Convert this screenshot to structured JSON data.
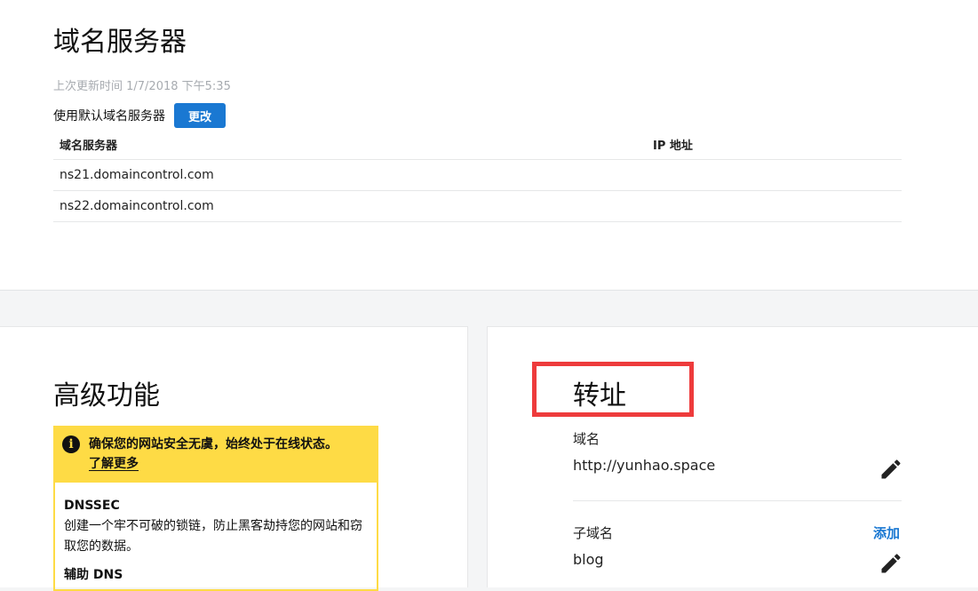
{
  "nameservers": {
    "title": "域名服务器",
    "last_updated": "上次更新时间 1/7/2018 下午5:35",
    "mode_text": "使用默认域名服务器",
    "change_button": "更改",
    "columns": {
      "nameserver": "域名服务器",
      "ip": "IP 地址"
    },
    "rows": [
      {
        "nameserver": "ns21.domaincontrol.com",
        "ip": ""
      },
      {
        "nameserver": "ns22.domaincontrol.com",
        "ip": ""
      }
    ]
  },
  "advanced": {
    "title": "高级功能",
    "callout": {
      "icon": "info-icon",
      "message": "确保您的网站安全无虞，始终处于在线状态。",
      "learn_more": "了解更多"
    },
    "features": [
      {
        "title": "DNSSEC",
        "desc": "创建一个牢不可破的锁链，防止黑客劫持您的网站和窃取您的数据。"
      },
      {
        "title": "辅助 DNS",
        "desc": ""
      }
    ]
  },
  "forwarding": {
    "title": "转址",
    "domain_label": "域名",
    "domain_value": "http://yunhao.space",
    "subdomain_label": "子域名",
    "subdomain_add": "添加",
    "subdomain_value": "blog"
  },
  "colors": {
    "accent": "#1a78d2",
    "callout": "#fedb45",
    "highlight": "#ee3b3c"
  }
}
